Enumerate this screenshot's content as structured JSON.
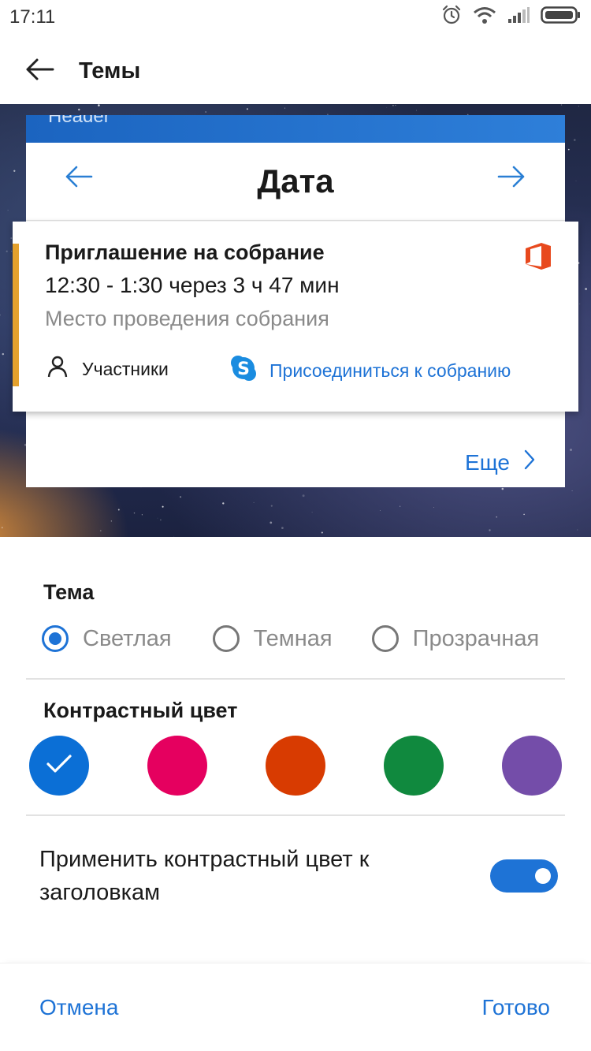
{
  "status_bar": {
    "time": "17:11",
    "icons": [
      "alarm-icon",
      "wifi-icon",
      "signal-icon",
      "battery-icon"
    ]
  },
  "app_bar": {
    "title": "Темы",
    "back_icon": "arrow-left-icon"
  },
  "preview": {
    "header_text": "Header",
    "date_title": "Дата",
    "event": {
      "title": "Приглашение на собрание",
      "time": "12:30 - 1:30 через 3 ч 47 мин",
      "location": "Место проведения собрания",
      "attendees_label": "Участники",
      "join_label": "Присоединиться к собранию",
      "accent_color": "#e4a12e",
      "app_icon": "office-icon"
    },
    "more_label": "Еще"
  },
  "theme": {
    "title": "Тема",
    "options": [
      {
        "label": "Светлая",
        "selected": true
      },
      {
        "label": "Темная",
        "selected": false
      },
      {
        "label": "Прозрачная",
        "selected": false
      }
    ]
  },
  "accent": {
    "title": "Контрастный цвет",
    "colors": [
      "#0b6fd6",
      "#e5005f",
      "#d83b01",
      "#10893e",
      "#744da9"
    ],
    "selected_index": 0
  },
  "apply_to_headers": {
    "label": "Применить контрастный цвет к заголовкам",
    "enabled": true
  },
  "footer": {
    "cancel_label": "Отмена",
    "done_label": "Готово"
  },
  "colors": {
    "link": "#1e73d6",
    "header_blue": "#1b64c0"
  }
}
